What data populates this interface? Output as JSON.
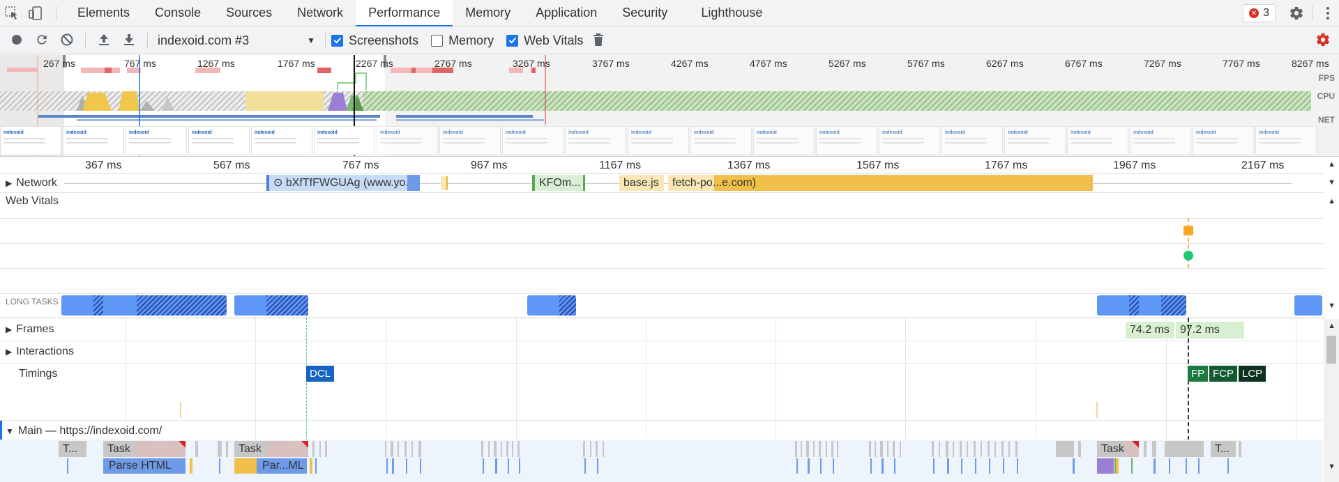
{
  "devtools": {
    "tabs": [
      {
        "label": "Elements",
        "active": false
      },
      {
        "label": "Console",
        "active": false
      },
      {
        "label": "Sources",
        "active": false
      },
      {
        "label": "Network",
        "active": false
      },
      {
        "label": "Performance",
        "active": true
      },
      {
        "label": "Memory",
        "active": false
      },
      {
        "label": "Application",
        "active": false
      },
      {
        "label": "Security",
        "active": false
      },
      {
        "label": "Lighthouse",
        "active": false
      }
    ],
    "error_count": "3",
    "icons": [
      "inspect-element-icon",
      "device-toolbar-icon",
      "settings-gear-icon",
      "more-vertical-icon"
    ]
  },
  "toolbar": {
    "profile_select": "indexoid.com #3",
    "checkboxes": [
      {
        "label": "Screenshots",
        "checked": true
      },
      {
        "label": "Memory",
        "checked": false
      },
      {
        "label": "Web Vitals",
        "checked": true
      }
    ],
    "icons": [
      "record-icon",
      "reload-icon",
      "clear-icon",
      "upload-icon",
      "download-icon",
      "trash-icon",
      "capture-settings-icon"
    ],
    "accent": "#1a73e8",
    "settings_color": "#d93025"
  },
  "overview": {
    "ticks": [
      "267 ms",
      "767 ms",
      "1267 ms",
      "1767 ms",
      "2267 ms",
      "2767 ms",
      "3267 ms",
      "3767 ms",
      "4267 ms",
      "4767 ms",
      "5267 ms",
      "5767 ms",
      "6267 ms",
      "6767 ms",
      "7267 ms",
      "7767 ms",
      "8267 ms"
    ],
    "labels": {
      "fps": "FPS",
      "cpu": "CPU",
      "net": "NET"
    },
    "screenshot_text": "indexoid"
  },
  "ruler": {
    "ticks": [
      "367 ms",
      "567 ms",
      "767 ms",
      "967 ms",
      "1167 ms",
      "1367 ms",
      "1567 ms",
      "1767 ms",
      "1967 ms",
      "2167 ms"
    ]
  },
  "tracks": {
    "network": "Network",
    "web_vitals": "Web Vitals",
    "long_tasks": "LONG TASKS",
    "frames": "Frames",
    "interactions": "Interactions",
    "timings": "Timings",
    "main": "Main — https://indexoid.com/"
  },
  "network_requests": [
    {
      "label": "⊙ bXfTfFWGUAg (www.yo..."
    },
    {
      "label": "KFOm..."
    },
    {
      "label": "base.js"
    },
    {
      "label": "fetch-po...e.com)"
    }
  ],
  "frames": [
    "74.2 ms",
    "97.2 ms"
  ],
  "timings": [
    {
      "label": "DCL",
      "color": "#1565c0"
    },
    {
      "label": "FP",
      "color": "#1b7a3e"
    },
    {
      "label": "FCP",
      "color": "#145a32"
    },
    {
      "label": "LCP",
      "color": "#0d3320"
    }
  ],
  "web_vitals_markers": {
    "lcp_color": "#f9a825",
    "fcp_color": "#1ec770"
  },
  "main_thread": {
    "tasks": [
      "T...",
      "Task",
      "Task",
      "Task",
      "T..."
    ],
    "subtasks": [
      "Parse HTML",
      "Par...ML"
    ]
  }
}
